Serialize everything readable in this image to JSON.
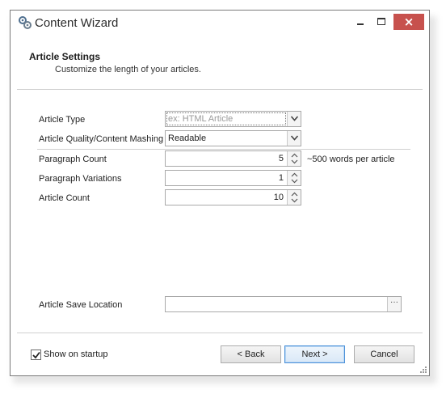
{
  "window": {
    "title": "Content Wizard",
    "close_glyph": "×"
  },
  "header": {
    "title": "Article Settings",
    "subtitle": "Customize the length of your articles."
  },
  "form": {
    "article_type": {
      "label": "Article Type",
      "placeholder": "ex: HTML Article"
    },
    "article_quality": {
      "label": "Article Quality/Content Mashing",
      "value": "Readable"
    },
    "paragraph_count": {
      "label": "Paragraph Count",
      "value": "5",
      "hint": "~500 words per article"
    },
    "paragraph_variations": {
      "label": "Paragraph Variations",
      "value": "1"
    },
    "article_count": {
      "label": "Article Count",
      "value": "10"
    },
    "save_location": {
      "label": "Article Save Location",
      "value": "",
      "browse_label": "···"
    }
  },
  "footer": {
    "show_on_startup": {
      "label": "Show on startup",
      "checked": true
    },
    "back_label": "< Back",
    "next_label": "Next >",
    "cancel_label": "Cancel"
  },
  "icons": {
    "app": "gears-icon",
    "minimize": "minimize-icon",
    "maximize": "maximize-icon",
    "close": "close-icon",
    "dropdown": "chevron-down-icon",
    "spin_up": "spin-up-icon",
    "spin_down": "spin-down-icon",
    "check": "checkmark-icon"
  },
  "colors": {
    "close_button": "#c7514d",
    "default_button_border": "#4a90d9"
  }
}
